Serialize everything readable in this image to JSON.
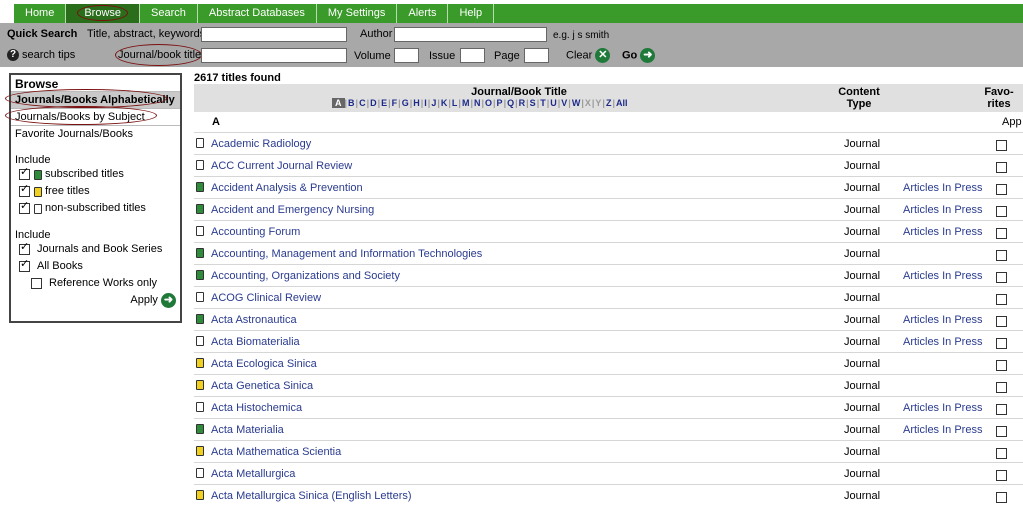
{
  "nav": {
    "tabs": [
      {
        "label": "Home"
      },
      {
        "label": "Browse",
        "active": true
      },
      {
        "label": "Search"
      },
      {
        "label": "Abstract Databases"
      },
      {
        "label": "My Settings"
      },
      {
        "label": "Alerts"
      },
      {
        "label": "Help"
      }
    ],
    "color": "#3a9a2a"
  },
  "quick_search": {
    "title": "Quick Search",
    "field_title_label": "Title, abstract, keywords",
    "field_title_value": "",
    "author_label": "Author",
    "author_value": "",
    "author_example": "e.g. j s smith",
    "search_tips": "search tips",
    "journal_label": "Journal/book title",
    "journal_value": "",
    "volume_label": "Volume",
    "issue_label": "Issue",
    "page_label": "Page",
    "clear_label": "Clear",
    "go_label": "Go"
  },
  "sidebar": {
    "title": "Browse",
    "items": [
      {
        "label": "Journals/Books Alphabetically",
        "selected": true
      },
      {
        "label": "Journals/Books by Subject"
      },
      {
        "label": "Favorite Journals/Books"
      }
    ],
    "include1": {
      "heading": "Include",
      "options": [
        {
          "label": "subscribed titles",
          "checked": true,
          "icon": "green-doc-icon"
        },
        {
          "label": "free titles",
          "checked": true,
          "icon": "yellow-doc-icon"
        },
        {
          "label": "non-subscribed titles",
          "checked": true,
          "icon": "white-doc-icon"
        }
      ]
    },
    "include2": {
      "heading": "Include",
      "options": [
        {
          "label": "Journals and Book Series",
          "checked": true
        },
        {
          "label": "All Books",
          "checked": true
        },
        {
          "label": "Reference Works only",
          "checked": false
        }
      ]
    },
    "apply_label": "Apply"
  },
  "results": {
    "count_text": "2617 titles found",
    "col_title": "Journal/Book Title",
    "col_type_line1": "Content",
    "col_type_line2": "Type",
    "col_fav_line1": "Favo-",
    "col_fav_line2": "rites",
    "letters": [
      "A",
      "B",
      "C",
      "D",
      "E",
      "F",
      "G",
      "H",
      "I",
      "J",
      "K",
      "L",
      "M",
      "N",
      "O",
      "P",
      "Q",
      "R",
      "S",
      "T",
      "U",
      "V",
      "W",
      "X",
      "Y",
      "Z",
      "All"
    ],
    "selected_letter": "A",
    "disabled_letters": [
      "X",
      "Y"
    ],
    "section_letter": "A",
    "app_label": "App",
    "rows": [
      {
        "title": "Academic Radiology",
        "type": "Journal",
        "aip": "",
        "access": "w"
      },
      {
        "title": "ACC Current Journal Review",
        "type": "Journal",
        "aip": "",
        "access": "w"
      },
      {
        "title": "Accident Analysis & Prevention",
        "type": "Journal",
        "aip": "Articles In Press",
        "access": "g"
      },
      {
        "title": "Accident and Emergency Nursing",
        "type": "Journal",
        "aip": "Articles In Press",
        "access": "g"
      },
      {
        "title": "Accounting Forum",
        "type": "Journal",
        "aip": "Articles In Press",
        "access": "w"
      },
      {
        "title": "Accounting, Management and Information Technologies",
        "type": "Journal",
        "aip": "",
        "access": "g"
      },
      {
        "title": "Accounting, Organizations and Society",
        "type": "Journal",
        "aip": "Articles In Press",
        "access": "g"
      },
      {
        "title": "ACOG Clinical Review",
        "type": "Journal",
        "aip": "",
        "access": "w"
      },
      {
        "title": "Acta Astronautica",
        "type": "Journal",
        "aip": "Articles In Press",
        "access": "g"
      },
      {
        "title": "Acta Biomaterialia",
        "type": "Journal",
        "aip": "Articles In Press",
        "access": "w"
      },
      {
        "title": "Acta Ecologica Sinica",
        "type": "Journal",
        "aip": "",
        "access": "y"
      },
      {
        "title": "Acta Genetica Sinica",
        "type": "Journal",
        "aip": "",
        "access": "y"
      },
      {
        "title": "Acta Histochemica",
        "type": "Journal",
        "aip": "Articles In Press",
        "access": "w"
      },
      {
        "title": "Acta Materialia",
        "type": "Journal",
        "aip": "Articles In Press",
        "access": "g"
      },
      {
        "title": "Acta Mathematica Scientia",
        "type": "Journal",
        "aip": "",
        "access": "y"
      },
      {
        "title": "Acta Metallurgica",
        "type": "Journal",
        "aip": "",
        "access": "w"
      },
      {
        "title": "Acta Metallurgica Sinica (English Letters)",
        "type": "Journal",
        "aip": "",
        "access": "y"
      }
    ]
  }
}
